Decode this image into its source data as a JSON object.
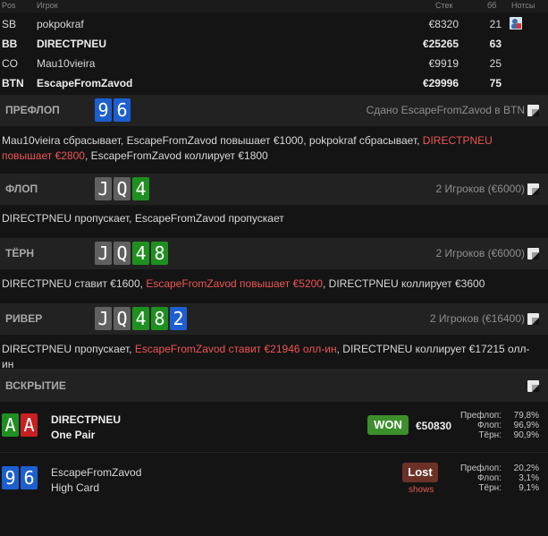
{
  "header": {
    "pos": "Pos",
    "player": "Игрок",
    "stack": "Стек",
    "bb": "бб",
    "notes": "Нотсы"
  },
  "players": [
    {
      "pos": "SB",
      "name": "pokpokraf",
      "stack": "€8320",
      "bb": "21",
      "bold": false,
      "note_icon": "profile-note-icon"
    },
    {
      "pos": "BB",
      "name": "DIRECTPNEU",
      "stack": "€25265",
      "bb": "63",
      "bold": true
    },
    {
      "pos": "CO",
      "name": "Mau10vieira",
      "stack": "€9919",
      "bb": "25",
      "bold": false
    },
    {
      "pos": "BTN",
      "name": "EscapeFromZavod",
      "stack": "€29996",
      "bb": "75",
      "bold": true
    }
  ],
  "preflop": {
    "label": "ПРЕФЛОП",
    "cards": [
      {
        "rank": "9",
        "suit": "d"
      },
      {
        "rank": "6",
        "suit": "d"
      }
    ],
    "info": "Сдано EscapeFromZavod в BTN",
    "action_a": "Mau10vieira сбрасывает, EscapeFromZavod повышает €1000, pokpokraf сбрасывает, ",
    "action_red": "DIRECTPNEU повышает €2800",
    "action_b": ", EscapeFromZavod коллирует €1800"
  },
  "flop": {
    "label": "ФЛОП",
    "cards": [
      {
        "rank": "J",
        "suit": "s"
      },
      {
        "rank": "Q",
        "suit": "s"
      },
      {
        "rank": "4",
        "suit": "c"
      }
    ],
    "info": "2 Игроков (€6000)",
    "action": "DIRECTPNEU пропускает, EscapeFromZavod пропускает"
  },
  "turn": {
    "label": "ТЁРН",
    "cards": [
      {
        "rank": "J",
        "suit": "s"
      },
      {
        "rank": "Q",
        "suit": "s"
      },
      {
        "rank": "4",
        "suit": "c"
      },
      {
        "rank": "8",
        "suit": "c"
      }
    ],
    "info": "2 Игроков (€6000)",
    "action_a": "DIRECTPNEU ставит €1600, ",
    "action_red": "EscapeFromZavod повышает €5200",
    "action_b": ", DIRECTPNEU коллирует €3600"
  },
  "river": {
    "label": "РИВЕР",
    "cards": [
      {
        "rank": "J",
        "suit": "s"
      },
      {
        "rank": "Q",
        "suit": "s"
      },
      {
        "rank": "4",
        "suit": "c"
      },
      {
        "rank": "8",
        "suit": "c"
      },
      {
        "rank": "2",
        "suit": "d"
      }
    ],
    "info": "2 Игроков (€16400)",
    "action_a": "DIRECTPNEU пропускает, ",
    "action_red": "EscapeFromZavod ставит €21946 олл-ин",
    "action_b": ", DIRECTPNEU коллирует €17215 олл-ин"
  },
  "showdown": {
    "label": "ВСКРЫТИЕ",
    "results": [
      {
        "cards": [
          {
            "rank": "A",
            "suit": "c"
          },
          {
            "rank": "A",
            "suit": "h"
          }
        ],
        "name": "DIRECTPNEU",
        "hand": "One Pair",
        "bold": true,
        "badge": "WON",
        "amount": "€50830",
        "stats": [
          {
            "label": "Префлоп:",
            "value": "79,8%"
          },
          {
            "label": "Флоп:",
            "value": "96,9%"
          },
          {
            "label": "Тёрн:",
            "value": "90,9%"
          }
        ]
      },
      {
        "cards": [
          {
            "rank": "9",
            "suit": "d"
          },
          {
            "rank": "6",
            "suit": "d"
          }
        ],
        "name": "EscapeFromZavod",
        "hand": "High Card",
        "bold": false,
        "badge": "Lost",
        "sub": "shows",
        "stats": [
          {
            "label": "Префлоп:",
            "value": "20,2%"
          },
          {
            "label": "Флоп:",
            "value": "3,1%"
          },
          {
            "label": "Тёрн:",
            "value": "9,1%"
          }
        ]
      }
    ]
  },
  "colors": {
    "club": "#1f8f1f",
    "diamond": "#1e5fd0",
    "spade": "#606060",
    "heart": "#c82020",
    "won": "#3d8f2c",
    "lost": "#6b3127",
    "highlight": "#ee5555"
  }
}
